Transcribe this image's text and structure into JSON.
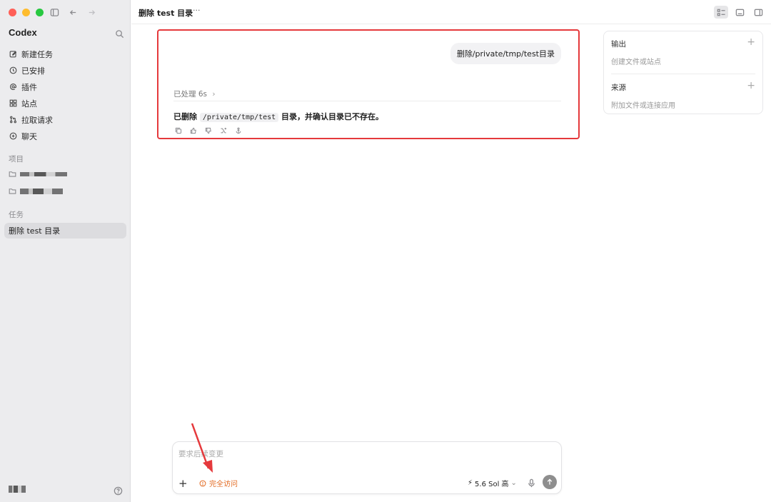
{
  "sidebar": {
    "app_title": "Codex",
    "nav": [
      {
        "label": "新建任务",
        "icon": "edit-icon"
      },
      {
        "label": "已安排",
        "icon": "clock-icon"
      },
      {
        "label": "插件",
        "icon": "at-icon"
      },
      {
        "label": "站点",
        "icon": "grid-icon"
      },
      {
        "label": "拉取请求",
        "icon": "pull-request-icon"
      },
      {
        "label": "聊天",
        "icon": "chat-icon"
      }
    ],
    "projects_label": "项目",
    "tasks_label": "任务",
    "active_task": "删除 test 目录"
  },
  "header": {
    "title": "删除 test 目录",
    "more": "···"
  },
  "conversation": {
    "user_message": "删除/private/tmp/test目录",
    "processed": "已处理 6s",
    "answer_prefix": "已删除",
    "answer_code": "/private/tmp/test",
    "answer_suffix": "目录，并确认目录已不存在。"
  },
  "side_panel": {
    "output_title": "输出",
    "output_sub": "创建文件或站点",
    "source_title": "来源",
    "source_sub": "附加文件或连接应用"
  },
  "composer": {
    "placeholder": "要求后续变更",
    "access_label": "完全访问",
    "model_label": "5.6 Sol 高"
  },
  "colors": {
    "highlight": "#e5393c",
    "access": "#e26a21",
    "annotation_arrow": "#e5393c"
  }
}
